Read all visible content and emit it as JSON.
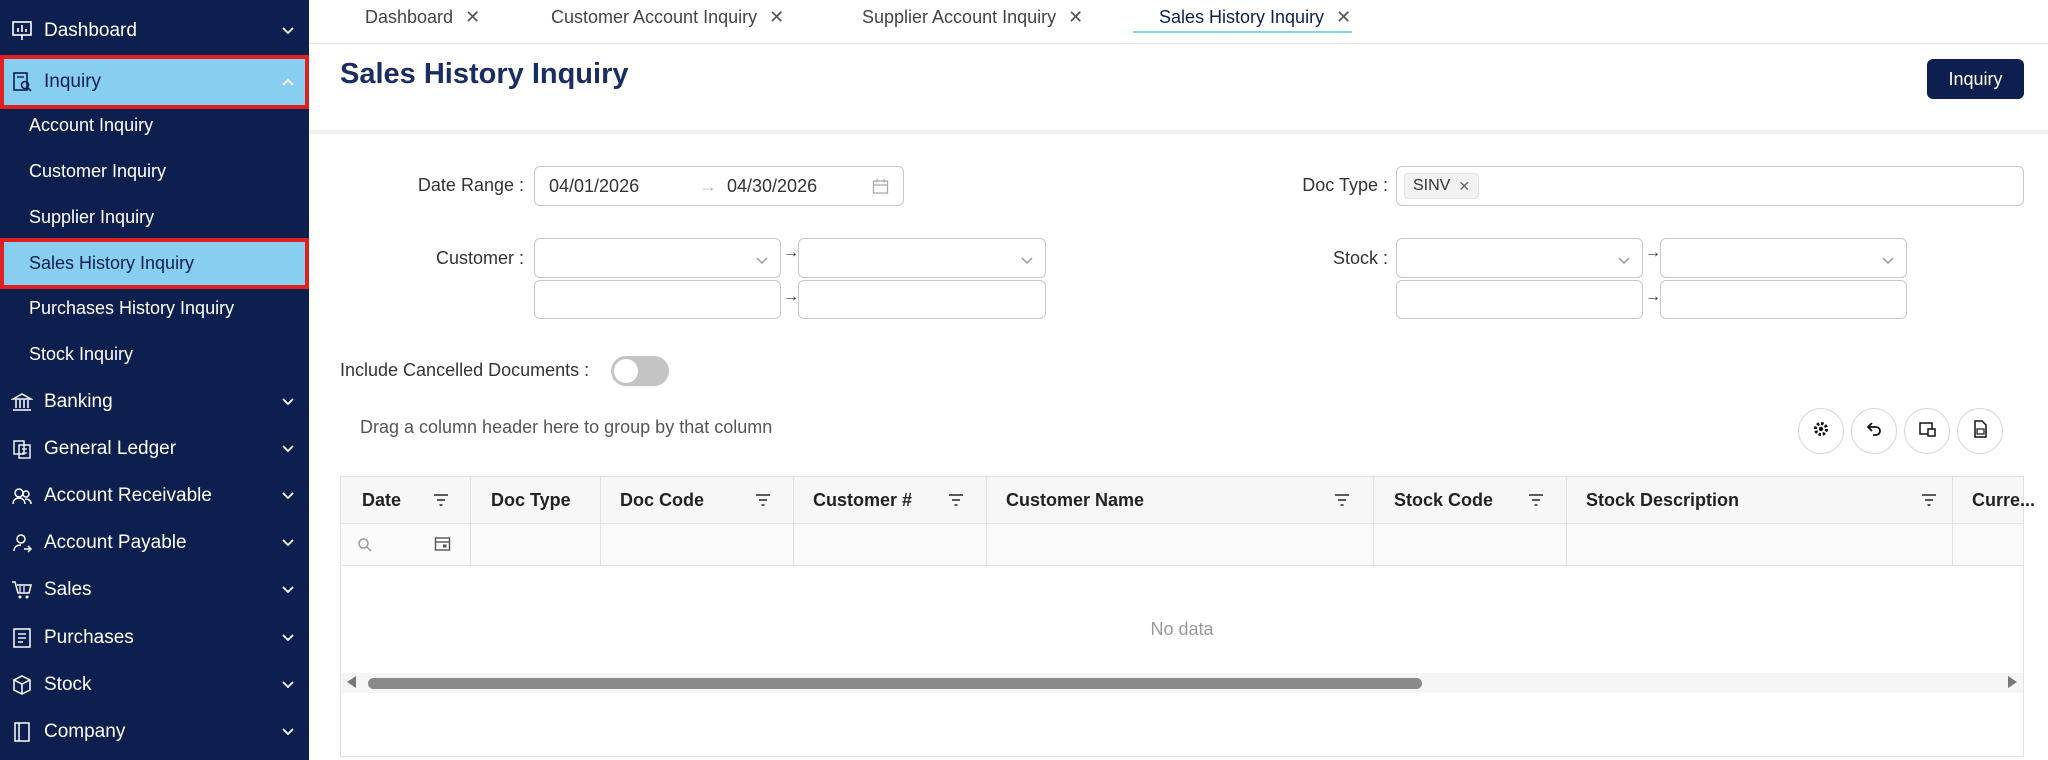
{
  "sidebar": {
    "items": [
      {
        "label": "Dashboard",
        "icon": "chart-board-icon"
      },
      {
        "label": "Inquiry",
        "icon": "inquiry-doc-icon"
      },
      {
        "label": "Banking",
        "icon": "bank-icon"
      },
      {
        "label": "General Ledger",
        "icon": "ledger-icon"
      },
      {
        "label": "Account Receivable",
        "icon": "receivable-icon"
      },
      {
        "label": "Account Payable",
        "icon": "payable-icon"
      },
      {
        "label": "Sales",
        "icon": "cart-icon"
      },
      {
        "label": "Purchases",
        "icon": "purchases-icon"
      },
      {
        "label": "Stock",
        "icon": "box-icon"
      },
      {
        "label": "Company",
        "icon": "book-icon"
      }
    ],
    "inquiry_subitems": [
      "Account Inquiry",
      "Customer Inquiry",
      "Supplier Inquiry",
      "Sales History Inquiry",
      "Purchases History Inquiry",
      "Stock Inquiry"
    ],
    "highlight_color": "#87cef0",
    "background_color": "#0d1f4e"
  },
  "tabs": [
    {
      "label": "Dashboard"
    },
    {
      "label": "Customer Account Inquiry"
    },
    {
      "label": "Supplier Account Inquiry"
    },
    {
      "label": "Sales History Inquiry",
      "active": true
    }
  ],
  "page": {
    "title": "Sales History Inquiry",
    "inquiry_button": "Inquiry"
  },
  "form": {
    "date_range_label": "Date Range :",
    "date_from": "04/01/2026",
    "date_to": "04/30/2026",
    "doc_type_label": "Doc Type :",
    "doc_type_tag": "SINV",
    "customer_label": "Customer :",
    "stock_label": "Stock :",
    "include_cancelled_label": "Include Cancelled Documents :",
    "include_cancelled_value": false
  },
  "grid": {
    "group_hint": "Drag a column header here to group by that column",
    "columns": [
      "Date",
      "Doc Type",
      "Doc Code",
      "Customer #",
      "Customer Name",
      "Stock Code",
      "Stock Description",
      "Curre..."
    ],
    "empty_text": "No data",
    "toolbar_icons": [
      "gear-icon",
      "undo-icon",
      "column-chooser-icon",
      "export-excel-icon"
    ]
  }
}
